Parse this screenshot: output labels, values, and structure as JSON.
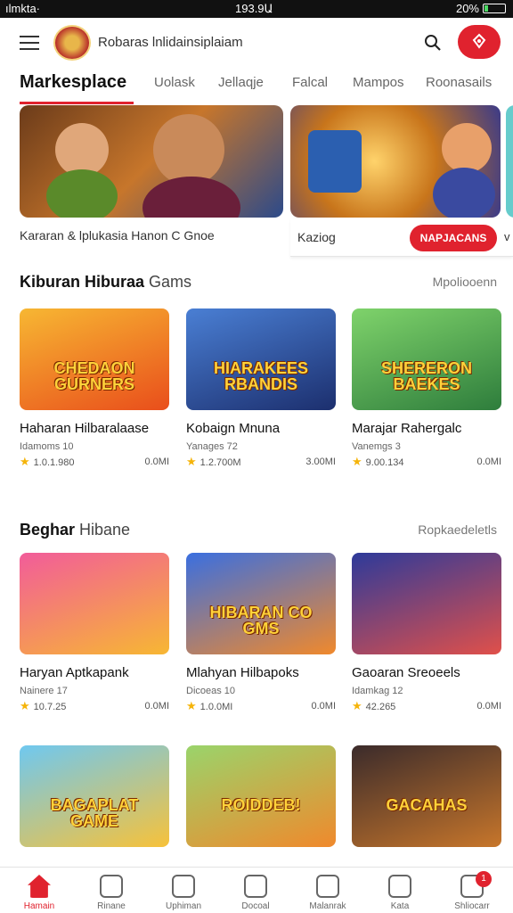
{
  "status_bar": {
    "carrier": "ılmkta·",
    "time": "193.9Ա",
    "battery": "20%",
    "battery_level": 0.2
  },
  "header": {
    "app_title": "Robaras lnlidainsiplaiam"
  },
  "tabs": [
    {
      "label": "Markesplace",
      "active": true
    },
    {
      "label": "Uolask"
    },
    {
      "label": "Jellaqje"
    },
    {
      "label": "Falcal"
    },
    {
      "label": "Mampos"
    },
    {
      "label": "Roonasails"
    }
  ],
  "banners": {
    "caption": "Kararan & lplukasia Hanon C Gnoe",
    "secondary_label": "Kaziog",
    "secondary_button": "NAPJACANS",
    "secondary_tail": "v"
  },
  "sections": [
    {
      "title_bold": "Kiburan Hiburaa",
      "title_light": "Gams",
      "link": "Mpoliooenn",
      "cards": [
        {
          "thumb_text": "CHEDAON GURNERS",
          "title": "Haharan Hilbaralaase",
          "sub": "Idamoms 10",
          "rating": "1.0.1.980",
          "size": "0.0MI",
          "colors": [
            "#f7b733",
            "#e94e1b"
          ]
        },
        {
          "thumb_text": "HIARAKEES RBANDIS",
          "title": "Kobaign Mnuna",
          "sub": "Yanages 72",
          "rating": "1.2.700M",
          "size": "3.00MI",
          "colors": [
            "#4a7fd4",
            "#1c2f6e"
          ]
        },
        {
          "thumb_text": "SHERERON BAEKES",
          "title": "Marajar Rahergalc",
          "sub": "Vanemgs 3",
          "rating": "9.00.134",
          "size": "0.0MI",
          "colors": [
            "#7fd36b",
            "#2e7d3c"
          ]
        }
      ]
    },
    {
      "title_bold": "Beghar",
      "title_light": "Hibane",
      "link": "Ropkaedeletls",
      "cards": [
        {
          "thumb_text": "",
          "title": "Haryan Aptkapank",
          "sub": "Nainere 17",
          "rating": "10.7.25",
          "size": "0.0MI",
          "colors": [
            "#f25c9a",
            "#f7b733"
          ]
        },
        {
          "thumb_text": "HIBARAN CO GMS",
          "title": "Mlahyan Hilbapoks",
          "sub": "Dicoeas 10",
          "rating": "1.0.0MI",
          "size": "0.0MI",
          "colors": [
            "#3a6fe0",
            "#f0892c"
          ]
        },
        {
          "thumb_text": "",
          "title": "Gaoaran Sreoeels",
          "sub": "Idamkag 12",
          "rating": "42.265",
          "size": "0.0MI",
          "colors": [
            "#2d3a9a",
            "#e0504a"
          ]
        }
      ]
    },
    {
      "cards": [
        {
          "thumb_text": "BAGAPLAT GAME",
          "colors": [
            "#6fc8f0",
            "#f7c23a"
          ]
        },
        {
          "thumb_text": "ROIDDEB!",
          "colors": [
            "#9ad46b",
            "#f0892c"
          ]
        },
        {
          "thumb_text": "GACAHAS",
          "colors": [
            "#3b2b2b",
            "#c7762b"
          ]
        }
      ]
    }
  ],
  "bottom_nav": [
    {
      "label": "Hamain",
      "icon": "home-icon",
      "active": true
    },
    {
      "label": "Rinane",
      "icon": "games-icon"
    },
    {
      "label": "Uphiman",
      "icon": "library-icon"
    },
    {
      "label": "Docoal",
      "icon": "deals-icon"
    },
    {
      "label": "Malanrak",
      "icon": "community-icon"
    },
    {
      "label": "Kata",
      "icon": "rewards-icon"
    },
    {
      "label": "Shliocarr",
      "icon": "cart-icon",
      "badge": "1"
    }
  ]
}
